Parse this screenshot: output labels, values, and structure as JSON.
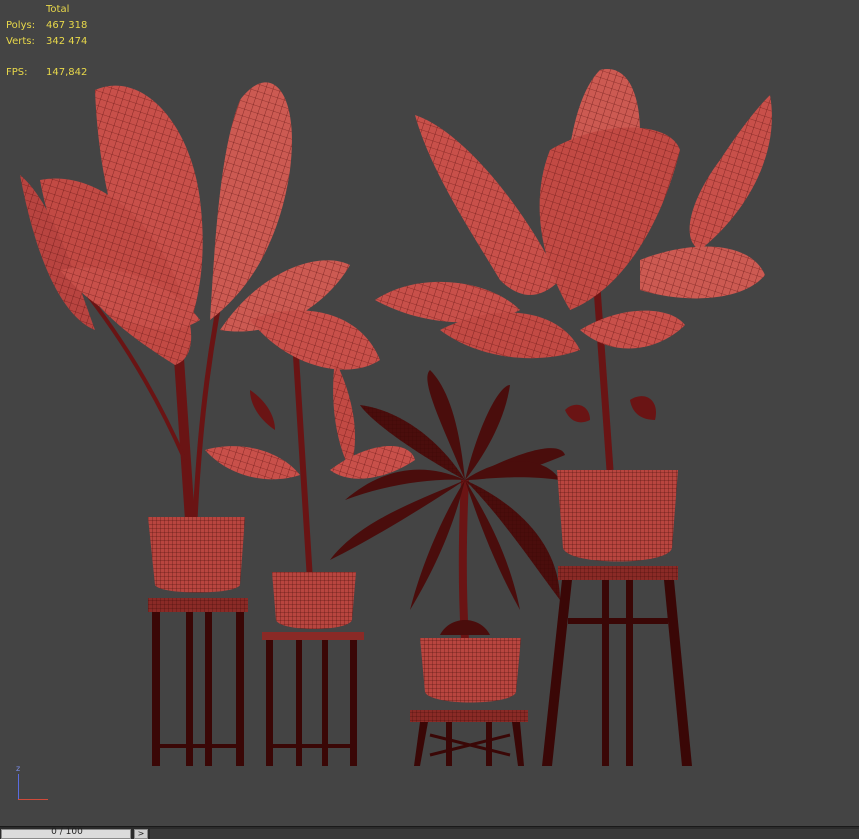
{
  "stats": {
    "header": "Total",
    "polys_label": "Polys:",
    "polys_value": "467 318",
    "verts_label": "Verts:",
    "verts_value": "342 474",
    "fps_label": "FPS:",
    "fps_value": "147,842"
  },
  "gizmo": {
    "z_label": "z"
  },
  "timeline": {
    "slider_label": "0 / 100",
    "next_glyph": ">",
    "position_fraction": 0.0
  },
  "colors": {
    "viewport_background": "#444444",
    "wireframe_fill": "#c8504a",
    "wireframe_line": "#5a0f0e",
    "stats_text": "#e8d84a"
  }
}
